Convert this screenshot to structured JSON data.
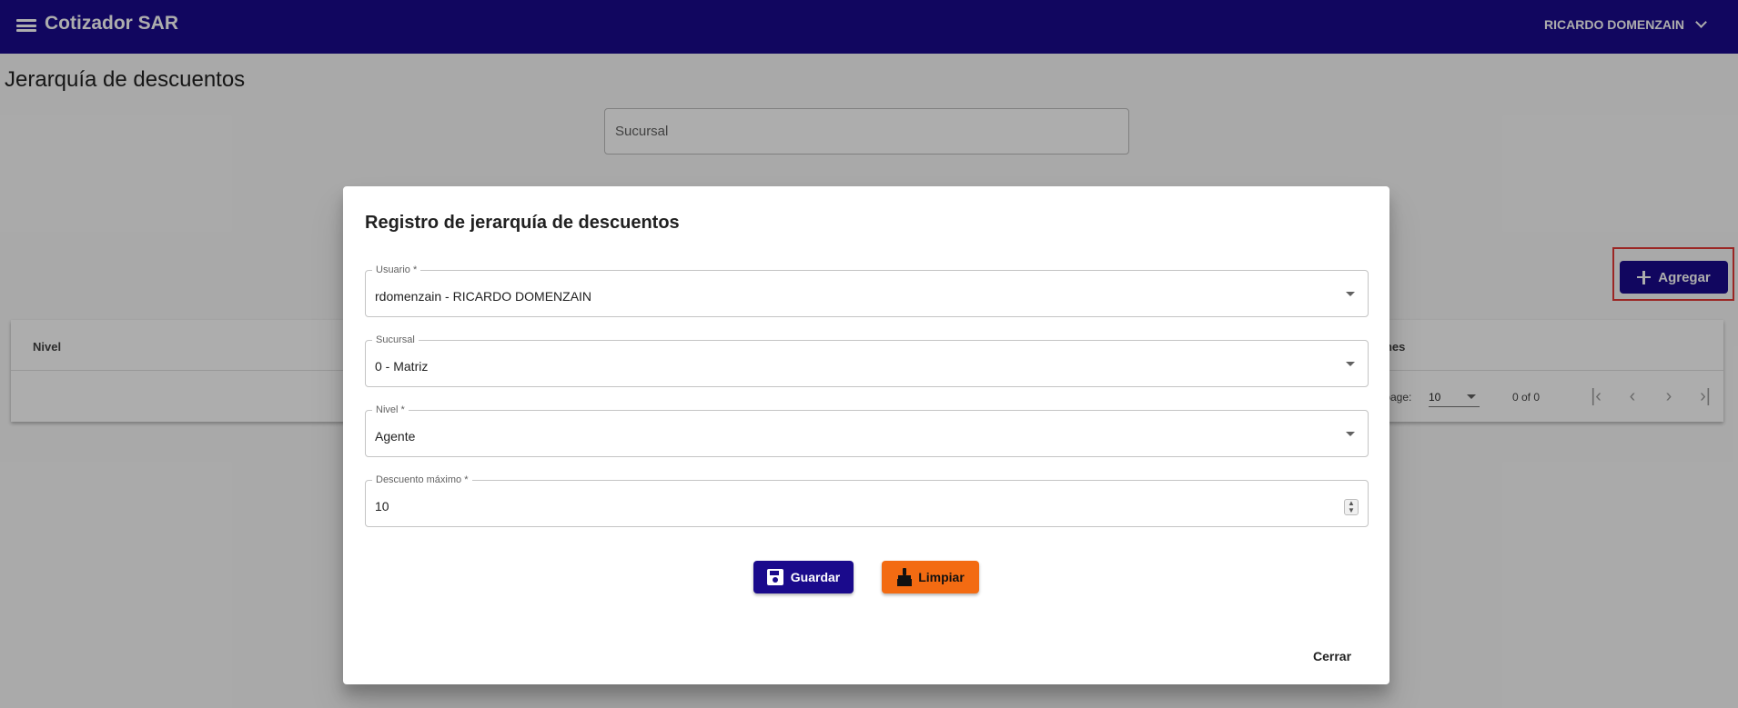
{
  "app": {
    "title": "Cotizador SAR",
    "user_name": "RICARDO DOMENZAIN"
  },
  "page": {
    "title": "Jerarquía de descuentos",
    "filter_placeholder": "Sucursal",
    "add_button_label": "Agregar"
  },
  "table": {
    "columns": [
      "Nivel",
      "ones"
    ],
    "paginator": {
      "items_per_page_label": "r page:",
      "page_size": "10",
      "range_label": "0 of 0"
    }
  },
  "dialog": {
    "title": "Registro de jerarquía de descuentos",
    "fields": [
      {
        "label": "Usuario *",
        "value": "rdomenzain - RICARDO DOMENZAIN"
      },
      {
        "label": "Sucursal",
        "value": "0 - Matriz"
      },
      {
        "label": "Nivel *",
        "value": "Agente"
      },
      {
        "label": "Descuento máximo *",
        "value": "10"
      }
    ],
    "save_label": "Guardar",
    "clear_label": "Limpiar",
    "close_label": "Cerrar"
  },
  "colors": {
    "primary": "#1a0a8c",
    "accent_orange": "#f36b12",
    "highlight_red": "#e53935"
  }
}
